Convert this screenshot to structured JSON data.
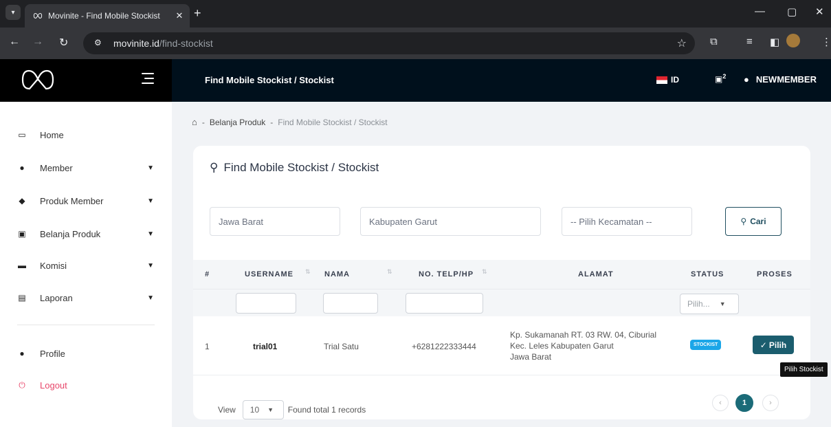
{
  "browser": {
    "tab_title": "Movinite - Find Mobile Stockist",
    "tab_close": "✕",
    "new_tab": "+",
    "url_domain": "movinite.id",
    "url_path": "/find-stockist",
    "win_minimize": "—",
    "win_restore": "▢",
    "win_close": "✕"
  },
  "header": {
    "page_title": "Find Mobile Stockist / Stockist",
    "language": "ID",
    "cart_count": "2",
    "username": "NEWMEMBER"
  },
  "sidebar": {
    "items": [
      {
        "label": "Home",
        "icon": "monitor-icon",
        "has_chevron": false
      },
      {
        "label": "Member",
        "icon": "user-icon",
        "has_chevron": true
      },
      {
        "label": "Produk Member",
        "icon": "tag-icon",
        "has_chevron": true
      },
      {
        "label": "Belanja Produk",
        "icon": "box-icon",
        "has_chevron": true
      },
      {
        "label": "Komisi",
        "icon": "card-icon",
        "has_chevron": true
      },
      {
        "label": "Laporan",
        "icon": "report-icon",
        "has_chevron": true
      }
    ],
    "profile": "Profile",
    "logout": "Logout"
  },
  "breadcrumb": {
    "separator": "-",
    "parent": "Belanja Produk",
    "current": "Find Mobile Stockist / Stockist"
  },
  "card": {
    "title": "Find Mobile Stockist / Stockist",
    "filters": {
      "province": "Jawa Barat",
      "city": "Kabupaten Garut",
      "district_placeholder": "-- Pilih Kecamatan --",
      "search_button": "Cari"
    },
    "table": {
      "columns": [
        "#",
        "USERNAME",
        "NAMA",
        "NO. TELP/HP",
        "ALAMAT",
        "STATUS",
        "PROSES"
      ],
      "status_filter": "Pilih...",
      "rows": [
        {
          "no": "1",
          "username": "trial01",
          "nama": "Trial Satu",
          "telp": "+6281222333444",
          "alamat_line1": "Kp. Sukamanah RT. 03 RW. 04, Ciburial",
          "alamat_line2": "Kec. Leles Kabupaten Garut",
          "alamat_line3": "Jawa Barat",
          "status": "STOCKIST",
          "action": "Pilih"
        }
      ]
    },
    "footer": {
      "view_label": "View",
      "page_size": "10",
      "records_text": "Found total 1 records",
      "current_page": "1",
      "prev": "‹",
      "next": "›"
    }
  },
  "tooltip": "Pilih Stockist",
  "colors": {
    "accent": "#1b5d6e",
    "badge": "#1ba6e8",
    "logout": "#e8466a",
    "header_bg": "#00101c"
  }
}
